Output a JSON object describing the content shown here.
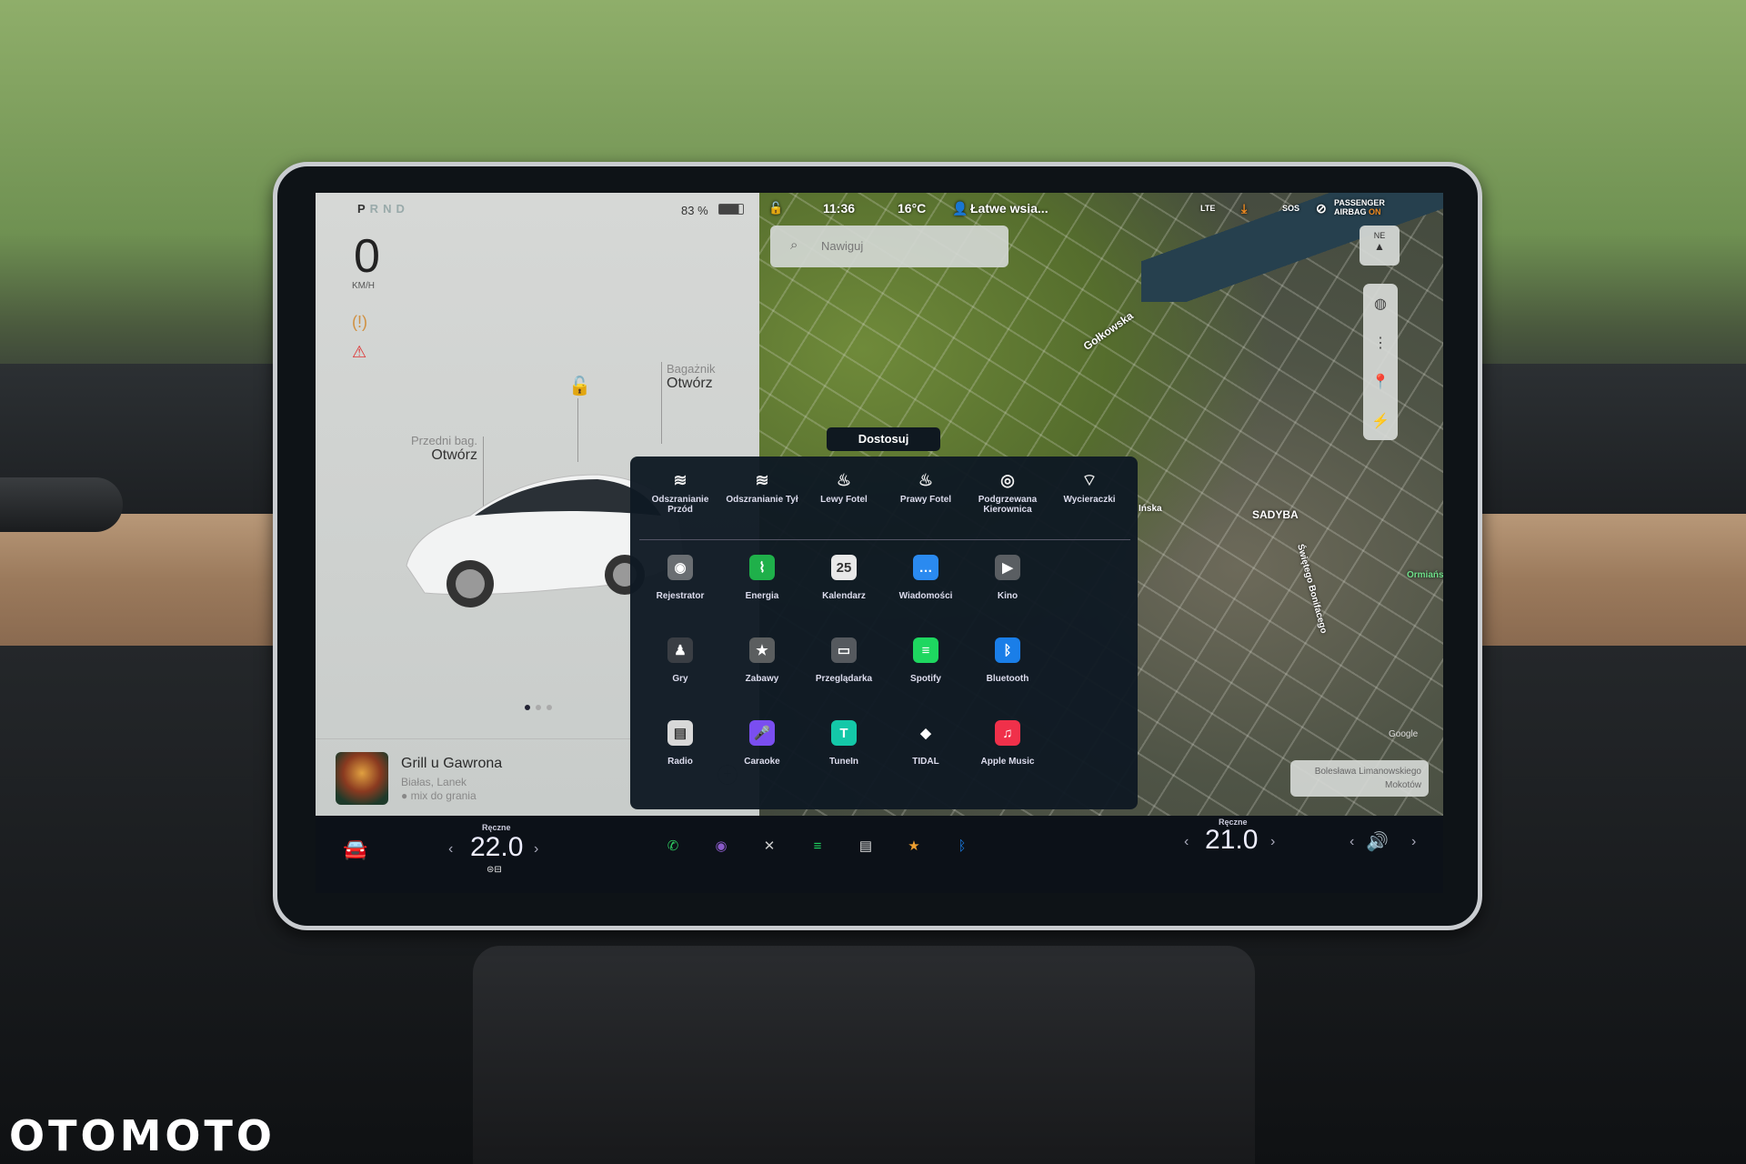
{
  "cluster": {
    "gears": [
      "P",
      "R",
      "N",
      "D"
    ],
    "active_gear": "P",
    "speed": "0",
    "speed_unit": "KM/H",
    "battery_percent": "83 %",
    "warning_icons": [
      "tire-pressure-icon",
      "seatbelt-icon"
    ]
  },
  "car_panel": {
    "frunk_label": "Przedni bag.",
    "frunk_action": "Otwórz",
    "trunk_label": "Bagażnik",
    "trunk_action": "Otwórz",
    "lock_state": "unlocked",
    "page_dots": 3,
    "active_page": 1
  },
  "media": {
    "title": "Grill u Gawrona",
    "artist": "Białas, Lanek",
    "source": "mix do grania",
    "add_icon": "+"
  },
  "status_bar": {
    "time": "11:36",
    "temperature": "16°C",
    "profile": "Łatwe wsia...",
    "network": "LTE",
    "sos": "SOS",
    "airbag_line1": "PASSENGER",
    "airbag_line2": "AIRBAG",
    "airbag_state": "ON"
  },
  "map": {
    "search_placeholder": "Nawiguj",
    "compass": "NE",
    "labels": [
      "Gołkowska",
      "SADYBA",
      "Świętego Bonifacego",
      "Ińska",
      "Ormiański"
    ],
    "attribution": "Google",
    "address_line1": "Bolesława Limanowskiego",
    "address_line2": "Mokotów",
    "tools": [
      "globe-icon",
      "traffic-icon",
      "pin-icon",
      "charging-icon"
    ]
  },
  "launcher": {
    "customize_label": "Dostosuj",
    "quick_controls": [
      {
        "label": "Odszranianie Przód",
        "icon": "≋"
      },
      {
        "label": "Odszranianie Tył",
        "icon": "≋"
      },
      {
        "label": "Lewy Fotel",
        "icon": "♨"
      },
      {
        "label": "Prawy Fotel",
        "icon": "♨"
      },
      {
        "label": "Podgrzewana Kierownica",
        "icon": "◎"
      },
      {
        "label": "Wycieraczki",
        "icon": "⌔"
      }
    ],
    "apps": [
      {
        "label": "Rejestrator",
        "icon": "◉",
        "color": "#6a6e72"
      },
      {
        "label": "Energia",
        "icon": "⌇",
        "color": "#1fb04a"
      },
      {
        "label": "Kalendarz",
        "icon": "25",
        "color": "#e8e8e8"
      },
      {
        "label": "Wiadomości",
        "icon": "…",
        "color": "#2a8af0"
      },
      {
        "label": "Kino",
        "icon": "▶",
        "color": "#5a5e62"
      },
      {
        "label": "Gry",
        "icon": "♟",
        "color": "#3a3e44"
      },
      {
        "label": "Zabawy",
        "icon": "★",
        "color": "#5b5e5f"
      },
      {
        "label": "Przeglądarka",
        "icon": "▭",
        "color": "#55595e"
      },
      {
        "label": "Spotify",
        "icon": "≡",
        "color": "#1ed760"
      },
      {
        "label": "Bluetooth",
        "icon": "ᛒ",
        "color": "#1a7ee8"
      },
      {
        "label": "Radio",
        "icon": "▤",
        "color": "#d8d8d8"
      },
      {
        "label": "Caraoke",
        "icon": "🎤",
        "color": "#7a4ef0"
      },
      {
        "label": "TuneIn",
        "icon": "T",
        "color": "#14c8a8"
      },
      {
        "label": "TIDAL",
        "icon": "◆",
        "color": "transparent"
      },
      {
        "label": "Apple Music",
        "icon": "♫",
        "color": "#f0304a"
      }
    ]
  },
  "taskbar": {
    "driver_temp_mode": "Ręczne",
    "driver_temp": "22.0",
    "passenger_temp_mode": "Ręczne",
    "passenger_temp": "21.0",
    "dock": [
      {
        "name": "phone-icon",
        "glyph": "✆",
        "color": "#2ecc60"
      },
      {
        "name": "camera-icon",
        "glyph": "◉",
        "color": "#8a5ac8"
      },
      {
        "name": "close-app-icon",
        "glyph": "✕",
        "color": "#ccc"
      },
      {
        "name": "spotify-icon",
        "glyph": "≡",
        "color": "#1ed760"
      },
      {
        "name": "radio-icon",
        "glyph": "▤",
        "color": "#ddd"
      },
      {
        "name": "toybox-icon",
        "glyph": "★",
        "color": "#f0a030"
      },
      {
        "name": "bluetooth-icon",
        "glyph": "ᛒ",
        "color": "#1a7ee8"
      }
    ],
    "volume_icon": "🔊"
  },
  "watermark": "OTOMOTO"
}
